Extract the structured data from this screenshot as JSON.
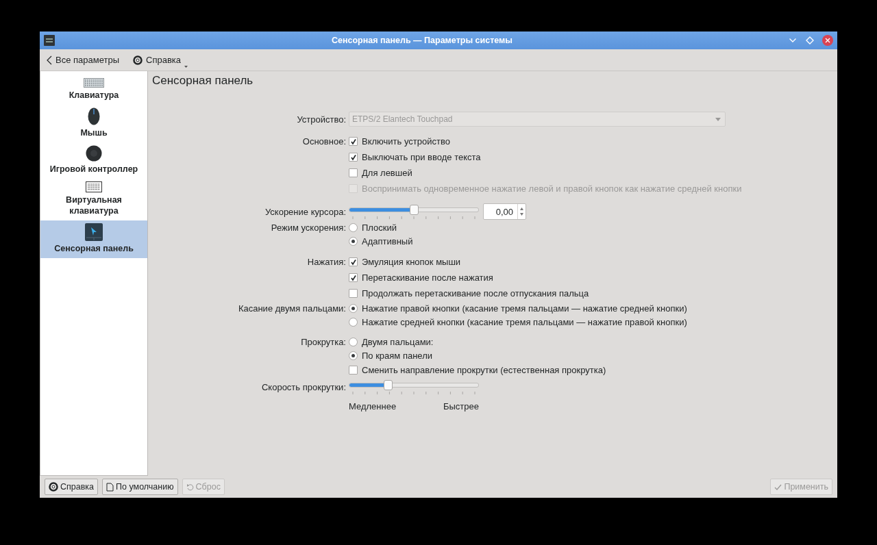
{
  "window": {
    "title": "Сенсорная панель — Параметры системы"
  },
  "toolbar": {
    "back": "Все параметры",
    "help": "Справка"
  },
  "sidebar": {
    "items": [
      {
        "label": "Клавиатура",
        "selected": false
      },
      {
        "label": "Мышь",
        "selected": false
      },
      {
        "label": "Игровой контроллер",
        "selected": false
      },
      {
        "label": "Виртуальная клавиатура",
        "selected": false
      },
      {
        "label": "Сенсорная панель",
        "selected": true
      }
    ]
  },
  "page_title": "Сенсорная панель",
  "form": {
    "groups": [
      {
        "rows": [
          {
            "kind": "dropdown",
            "label": "Устройство:",
            "value": "ETPS/2 Elantech Touchpad",
            "disabled": true
          }
        ]
      },
      {
        "rows": [
          {
            "kind": "checkbox",
            "label": "Основное:",
            "text": "Включить устройство",
            "checked": true,
            "disabled": false
          },
          {
            "kind": "checkbox",
            "text": "Выключать при вводе текста",
            "checked": true,
            "disabled": false
          },
          {
            "kind": "checkbox",
            "text": "Для левшей",
            "checked": false,
            "disabled": false
          },
          {
            "kind": "checkbox",
            "text": "Воспринимать одновременное нажатие левой и правой кнопок как нажатие средней кнопки",
            "checked": false,
            "disabled": true
          }
        ]
      },
      {
        "rows": [
          {
            "kind": "slider",
            "label": "Ускорение курсора:",
            "level": 0.5,
            "spin_value": "0,00"
          },
          {
            "kind": "radio",
            "label": "Режим ускорения:",
            "text": "Плоский",
            "selected": false
          },
          {
            "kind": "radio",
            "text": "Адаптивный",
            "selected": true
          }
        ]
      },
      {
        "rows": [
          {
            "kind": "checkbox",
            "label": "Нажатия:",
            "text": "Эмуляция кнопок мыши",
            "checked": true,
            "disabled": false
          },
          {
            "kind": "checkbox",
            "text": "Перетаскивание после нажатия",
            "checked": true,
            "disabled": false
          },
          {
            "kind": "checkbox",
            "text": "Продолжать перетаскивание после отпускания пальца",
            "checked": false,
            "disabled": false
          },
          {
            "kind": "radio",
            "label": "Касание двумя пальцами:",
            "text": "Нажатие правой кнопки (касание тремя пальцами — нажатие средней кнопки)",
            "selected": true
          },
          {
            "kind": "radio",
            "text": "Нажатие средней кнопки (касание тремя пальцами — нажатие правой кнопки)",
            "selected": false
          }
        ]
      },
      {
        "rows": [
          {
            "kind": "radio",
            "label": "Прокрутка:",
            "text": "Двумя пальцами:",
            "selected": false
          },
          {
            "kind": "radio",
            "text": "По краям панели",
            "selected": true
          },
          {
            "kind": "checkbox",
            "text": "Сменить направление прокрутки (естественная прокрутка)",
            "checked": false,
            "disabled": false
          },
          {
            "kind": "slider",
            "label": "Скорость прокрутки:",
            "level": 0.3,
            "min_label": "Медленнее",
            "max_label": "Быстрее"
          }
        ]
      }
    ]
  },
  "footer": {
    "buttons": [
      {
        "kind": "help",
        "label": "Справка",
        "disabled": false
      },
      {
        "kind": "defaults",
        "label": "По умолчанию",
        "disabled": false
      },
      {
        "kind": "reset",
        "label": "Сброс",
        "disabled": true
      },
      {
        "kind": "apply",
        "label": "Применить",
        "disabled": true
      }
    ]
  }
}
